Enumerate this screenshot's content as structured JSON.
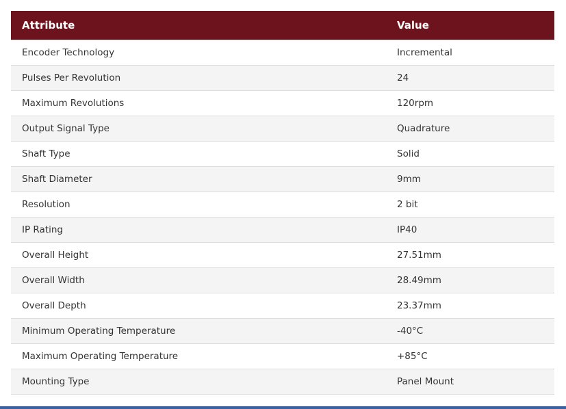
{
  "table": {
    "headers": {
      "attribute": "Attribute",
      "value": "Value"
    },
    "rows": [
      {
        "attribute": "Encoder Technology",
        "value": "Incremental"
      },
      {
        "attribute": "Pulses Per Revolution",
        "value": "24"
      },
      {
        "attribute": "Maximum Revolutions",
        "value": "120rpm"
      },
      {
        "attribute": "Output Signal Type",
        "value": "Quadrature"
      },
      {
        "attribute": "Shaft Type",
        "value": "Solid"
      },
      {
        "attribute": "Shaft Diameter",
        "value": "9mm"
      },
      {
        "attribute": "Resolution",
        "value": "2 bit"
      },
      {
        "attribute": "IP Rating",
        "value": "IP40"
      },
      {
        "attribute": "Overall Height",
        "value": "27.51mm"
      },
      {
        "attribute": "Overall Width",
        "value": "28.49mm"
      },
      {
        "attribute": "Overall Depth",
        "value": "23.37mm"
      },
      {
        "attribute": "Minimum Operating Temperature",
        "value": "-40°C"
      },
      {
        "attribute": "Maximum Operating Temperature",
        "value": "+85°C"
      },
      {
        "attribute": "Mounting Type",
        "value": "Panel Mount"
      }
    ]
  },
  "colors": {
    "header_background": "#6d131d",
    "header_text": "#ffffff",
    "row_alt_background": "#f4f4f4",
    "bottom_bar": "#3c5fa3"
  }
}
